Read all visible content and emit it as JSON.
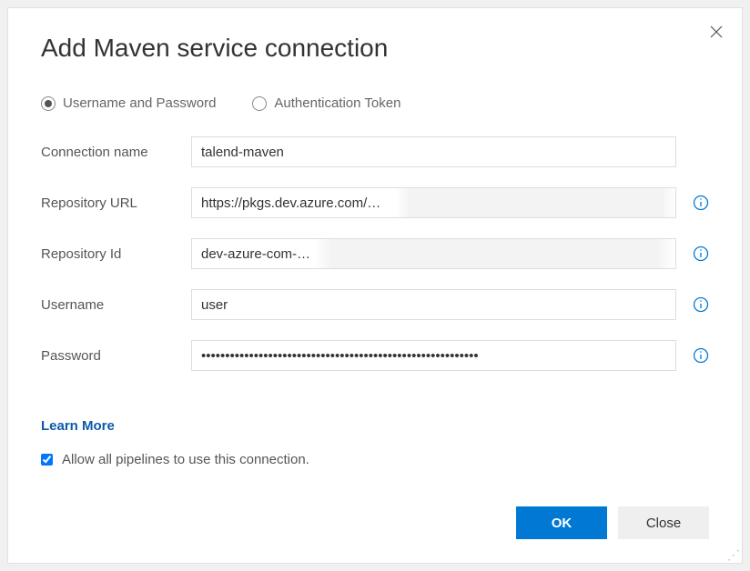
{
  "dialog": {
    "title": "Add Maven service connection",
    "learn_more": "Learn More",
    "allow_pipelines": "Allow all pipelines to use this connection."
  },
  "auth_type": {
    "username_password": "Username and Password",
    "token": "Authentication Token"
  },
  "fields": {
    "connection_name": {
      "label": "Connection name",
      "value": "talend-maven"
    },
    "repository_url": {
      "label": "Repository URL",
      "value": "https://pkgs.dev.azure.com/…"
    },
    "repository_id": {
      "label": "Repository Id",
      "value": "dev-azure-com-…"
    },
    "username": {
      "label": "Username",
      "value": "user"
    },
    "password": {
      "label": "Password",
      "value": "••••••••••••••••••••••••••••••••••••••••••••••••••••••••••"
    }
  },
  "buttons": {
    "ok": "OK",
    "close": "Close"
  }
}
